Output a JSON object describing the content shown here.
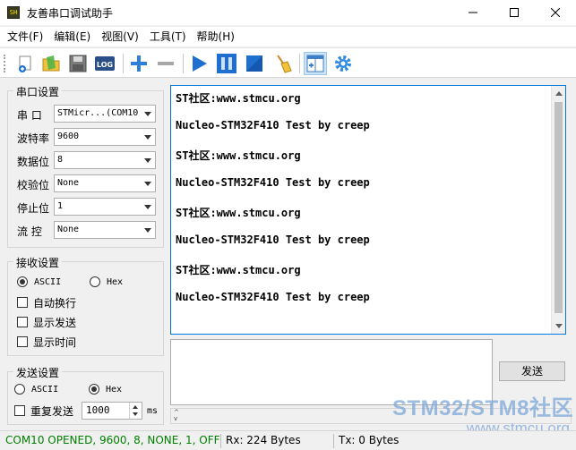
{
  "window": {
    "title": "友善串口调试助手",
    "app_icon_text": "SH",
    "controls": [
      "minimize",
      "maximize",
      "close"
    ]
  },
  "menu": {
    "items": [
      {
        "label": "文件(F)"
      },
      {
        "label": "编辑(E)"
      },
      {
        "label": "视图(V)"
      },
      {
        "label": "工具(T)"
      },
      {
        "label": "帮助(H)"
      }
    ]
  },
  "toolbar": {
    "icons": [
      "new-icon",
      "open-icon",
      "save-icon",
      "log-icon",
      "add-icon",
      "remove-icon",
      "play-icon",
      "pause-icon",
      "stop-icon",
      "clear-icon",
      "layout-icon",
      "settings-icon"
    ],
    "log_label": "LOG"
  },
  "serial_settings": {
    "title": "串口设置",
    "port": {
      "label": "串  口",
      "value": "STMicr...(COM10"
    },
    "baud": {
      "label": "波特率",
      "value": "9600"
    },
    "databits": {
      "label": "数据位",
      "value": "8"
    },
    "parity": {
      "label": "校验位",
      "value": "None"
    },
    "stopbits": {
      "label": "停止位",
      "value": "1"
    },
    "flow": {
      "label": "流  控",
      "value": "None"
    }
  },
  "receive_settings": {
    "title": "接收设置",
    "ascii": "ASCII",
    "hex": "Hex",
    "auto_wrap": "自动换行",
    "show_send": "显示发送",
    "show_time": "显示时间",
    "selected": "ASCII"
  },
  "send_settings": {
    "title": "发送设置",
    "ascii": "ASCII",
    "hex": "Hex",
    "selected": "Hex",
    "repeat_label": "重复发送",
    "interval": "1000",
    "unit": "ms"
  },
  "receive_text": {
    "lines": [
      "ST社区:www.stmcu.org",
      "Nucleo-STM32F410 Test by creep",
      "ST社区:www.stmcu.org",
      "Nucleo-STM32F410 Test by creep",
      "ST社区:www.stmcu.org",
      "Nucleo-STM32F410 Test by creep",
      "ST社区:www.stmcu.org",
      "Nucleo-STM32F410 Test by creep"
    ]
  },
  "send": {
    "button_label": "发送",
    "text": ""
  },
  "status": {
    "connection": "COM10 OPENED, 9600, 8, NONE, 1, OFF",
    "rx": "Rx: 224 Bytes",
    "tx": "Tx: 0 Bytes",
    "connection_color": "#008000"
  },
  "watermark": {
    "line1": "STM32/STM8社区",
    "line2": "www.stmcu.org"
  }
}
